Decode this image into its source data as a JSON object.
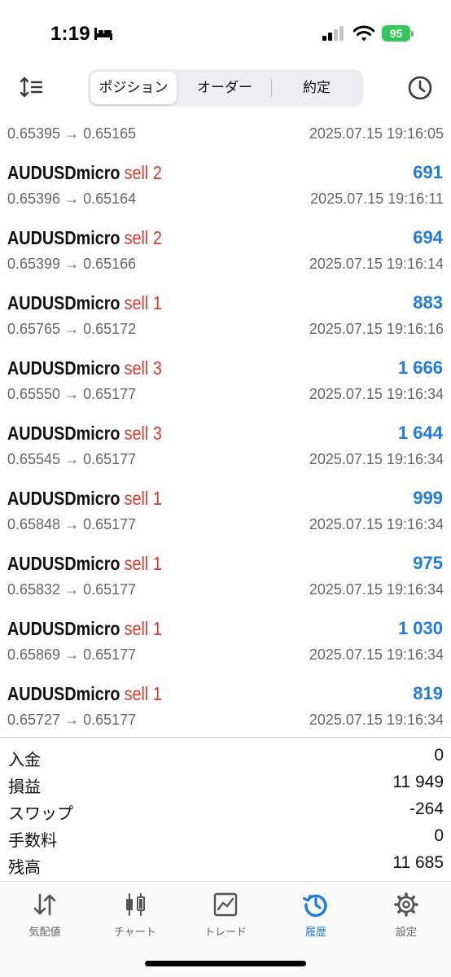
{
  "status_bar": {
    "time": "1:19",
    "battery": "95"
  },
  "toolbar": {
    "tabs": [
      {
        "label": "ポジション",
        "active": true
      },
      {
        "label": "オーダー",
        "active": false
      },
      {
        "label": "約定",
        "active": false
      }
    ]
  },
  "partial_row": {
    "prices": "0.65395 → 0.65165",
    "time": "2025.07.15 19:16:05"
  },
  "deals": [
    {
      "symbol": "AUDUSDmicro",
      "side": "sell 2",
      "profit": "691",
      "prices": "0.65396 → 0.65164",
      "time": "2025.07.15 19:16:11"
    },
    {
      "symbol": "AUDUSDmicro",
      "side": "sell 2",
      "profit": "694",
      "prices": "0.65399 → 0.65166",
      "time": "2025.07.15 19:16:14"
    },
    {
      "symbol": "AUDUSDmicro",
      "side": "sell 1",
      "profit": "883",
      "prices": "0.65765 → 0.65172",
      "time": "2025.07.15 19:16:16"
    },
    {
      "symbol": "AUDUSDmicro",
      "side": "sell 3",
      "profit": "1 666",
      "prices": "0.65550 → 0.65177",
      "time": "2025.07.15 19:16:34"
    },
    {
      "symbol": "AUDUSDmicro",
      "side": "sell 3",
      "profit": "1 644",
      "prices": "0.65545 → 0.65177",
      "time": "2025.07.15 19:16:34"
    },
    {
      "symbol": "AUDUSDmicro",
      "side": "sell 1",
      "profit": "999",
      "prices": "0.65848 → 0.65177",
      "time": "2025.07.15 19:16:34"
    },
    {
      "symbol": "AUDUSDmicro",
      "side": "sell 1",
      "profit": "975",
      "prices": "0.65832 → 0.65177",
      "time": "2025.07.15 19:16:34"
    },
    {
      "symbol": "AUDUSDmicro",
      "side": "sell 1",
      "profit": "1 030",
      "prices": "0.65869 → 0.65177",
      "time": "2025.07.15 19:16:34"
    },
    {
      "symbol": "AUDUSDmicro",
      "side": "sell 1",
      "profit": "819",
      "prices": "0.65727 → 0.65177",
      "time": "2025.07.15 19:16:34"
    }
  ],
  "summary": [
    {
      "label": "入金",
      "value": "0"
    },
    {
      "label": "損益",
      "value": "11 949"
    },
    {
      "label": "スワップ",
      "value": "-264"
    },
    {
      "label": "手数料",
      "value": "0"
    },
    {
      "label": "残高",
      "value": "11 685"
    }
  ],
  "tabbar": [
    {
      "label": "気配値",
      "icon": "quotes-icon",
      "active": false
    },
    {
      "label": "チャート",
      "icon": "chart-icon",
      "active": false
    },
    {
      "label": "トレード",
      "icon": "trade-icon",
      "active": false
    },
    {
      "label": "履歴",
      "icon": "history-icon",
      "active": true
    },
    {
      "label": "設定",
      "icon": "settings-icon",
      "active": false
    }
  ],
  "colors": {
    "sell": "#d63b2e",
    "profit": "#1f7be0",
    "active_tab": "#1f7be0",
    "battery": "#34c759"
  }
}
